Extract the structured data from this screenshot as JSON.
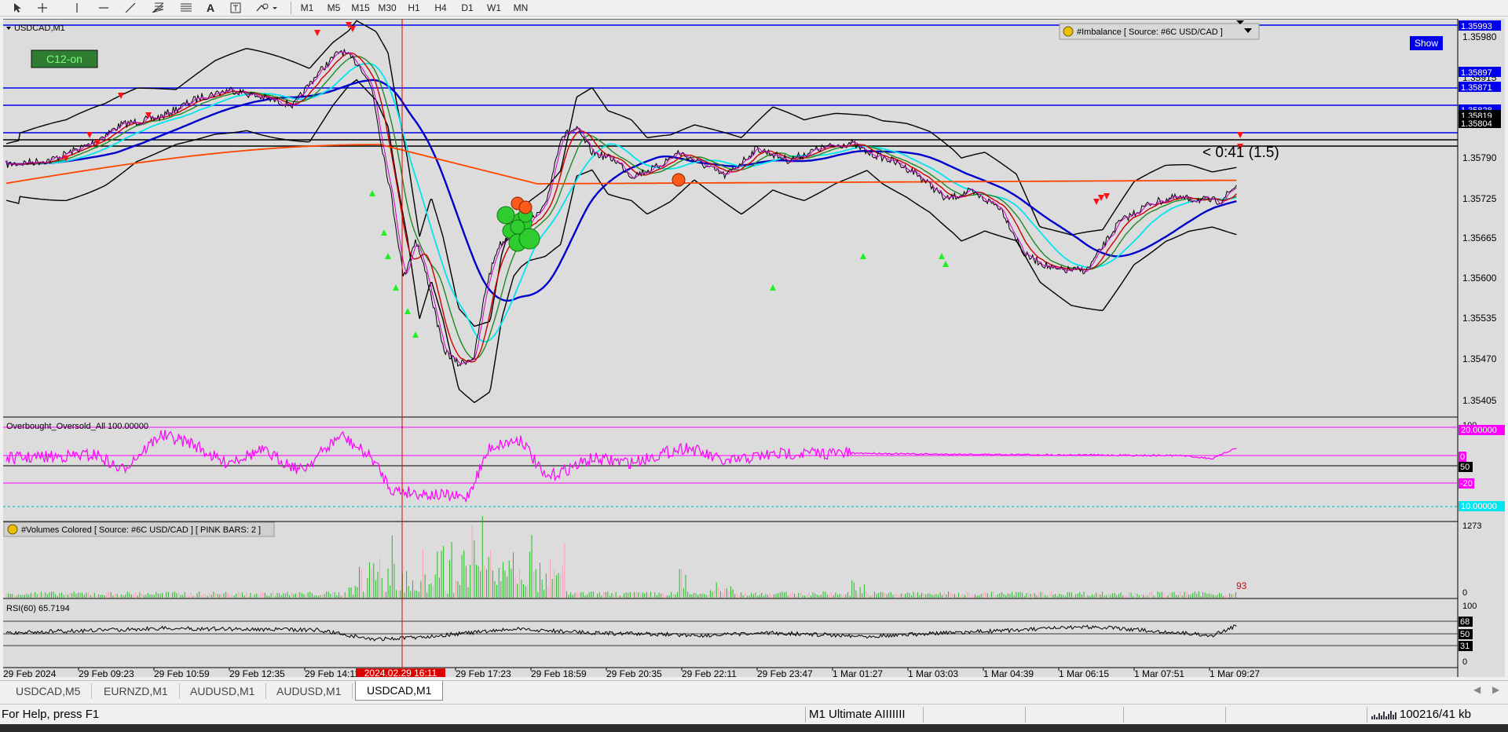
{
  "toolbar": {
    "tools": [
      "cursor-icon",
      "crosshair-icon",
      "vertical-line-icon",
      "horizontal-line-icon",
      "trendline-icon",
      "fibonacci-fan-icon",
      "fibonacci-icon",
      "text-icon",
      "text-label-icon",
      "shapes-icon"
    ],
    "timeframes": [
      "M1",
      "M5",
      "M15",
      "M30",
      "H1",
      "H4",
      "D1",
      "W1",
      "MN"
    ]
  },
  "chart": {
    "symbol_label": "USDCAD,M1",
    "c12_label": "C12-on",
    "imbalance_label": "#Imbalance [ Source: #6C USD/CAD ]",
    "show_button": "Show",
    "countdown": "< 0:41 (1.5)",
    "price_levels": [
      "1.35980",
      "1.35915",
      "1.35790",
      "1.35725",
      "1.35665",
      "1.35600",
      "1.35535",
      "1.35470",
      "1.35405"
    ],
    "price_tags": [
      {
        "label": "1.35993",
        "bg": "#0000ee"
      },
      {
        "label": "1.35897",
        "bg": "#0000ee"
      },
      {
        "label": "1.35871",
        "bg": "#0000ee"
      },
      {
        "label": "1.35828",
        "bg": "#0000ee"
      },
      {
        "label": "1.35819",
        "bg": "#000000"
      },
      {
        "label": "1.35804",
        "bg": "#000000"
      }
    ],
    "osc_title": "Overbought_Oversold_All 100.00000",
    "osc_levels": [
      "100",
      "20.00000",
      "0",
      "50",
      "-20",
      "10.00000"
    ],
    "volume_title": "#Volumes Colored [ Source: #6C USD/CAD ]  [ PINK BARS: 2 ]",
    "volume_levels": [
      "1273",
      "0"
    ],
    "volume_last": "93",
    "rsi_title": "RSI(60) 65.7194",
    "rsi_levels": [
      "100",
      "68",
      "50",
      "31",
      "0"
    ],
    "time_labels": [
      "29 Feb 2024",
      "29 Feb 09:23",
      "29 Feb 10:59",
      "29 Feb 12:35",
      "29 Feb 14:11",
      "29 Feb 17:23",
      "29 Feb 18:59",
      "29 Feb 20:35",
      "29 Feb 22:11",
      "29 Feb 23:47",
      "1 Mar 01:27",
      "1 Mar 03:03",
      "1 Mar 04:39",
      "1 Mar 06:15",
      "1 Mar 07:51",
      "1 Mar 09:27"
    ],
    "crosshair_time": "2024.02.29 16:11"
  },
  "tabs": [
    "USDCAD,M5",
    "EURNZD,M1",
    "AUDUSD,M1",
    "AUDUSD,M1",
    "USDCAD,M1"
  ],
  "active_tab": 4,
  "status": {
    "help": "For Help, press F1",
    "profile": "M1 Ultimate AIIIIIII",
    "traffic": "100216/41 kb"
  },
  "colors": {
    "accent_blue": "#0000ee",
    "magenta": "#ff00ff",
    "ma_orange": "#ff4500",
    "cyan": "#00e5ee",
    "crosshair_red": "#dd0000"
  }
}
